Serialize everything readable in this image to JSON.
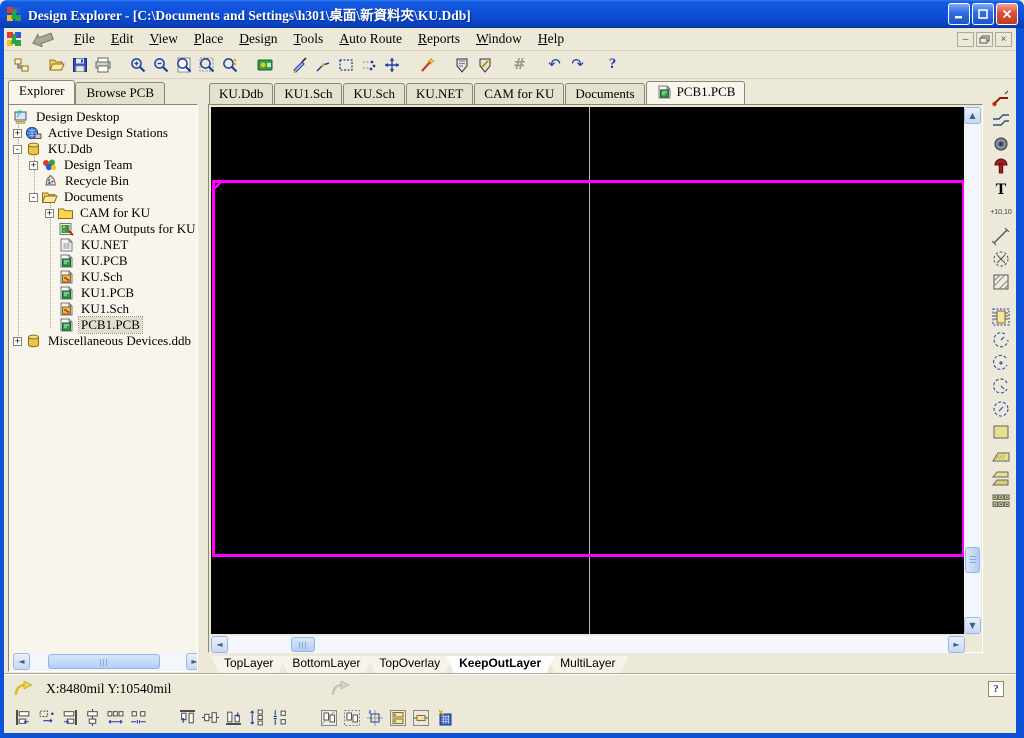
{
  "window": {
    "title": "Design Explorer - [C:\\Documents and Settings\\h301\\桌面\\新資料夾\\KU.Ddb]",
    "controls": [
      "minimize",
      "maximize",
      "close"
    ],
    "mdi_controls": [
      "minimize",
      "restore",
      "close"
    ],
    "mdi_glyphs": {
      "minimize": "–",
      "close": "×"
    }
  },
  "menu": {
    "items": [
      {
        "label": "File"
      },
      {
        "label": "Edit"
      },
      {
        "label": "View"
      },
      {
        "label": "Place"
      },
      {
        "label": "Design"
      },
      {
        "label": "Tools"
      },
      {
        "label": "Auto Route"
      },
      {
        "label": "Reports"
      },
      {
        "label": "Window"
      },
      {
        "label": "Help"
      }
    ]
  },
  "toolbar": {
    "icons": [
      "toggle-explorer-panel",
      "open-document",
      "save",
      "print",
      "zoom-in",
      "zoom-out",
      "zoom-document",
      "zoom-area",
      "zoom-selection",
      "browse-spreadsheet",
      "slice-tracks",
      "draw-line",
      "select-area",
      "clear-selection",
      "move-object",
      "wizard",
      "online-drc",
      "setup-drc",
      "toggle-grid",
      "undo",
      "redo",
      "help"
    ],
    "glyphs": {
      "grid": "#",
      "undo": "↶",
      "redo": "↷",
      "help": "?"
    }
  },
  "panel_tabs": [
    {
      "label": "Explorer",
      "active": true
    },
    {
      "label": "Browse PCB",
      "active": false
    }
  ],
  "tree": {
    "items": [
      {
        "label": "Design Desktop",
        "icon": "design-desktop",
        "level": 0,
        "expand": "",
        "selected": false
      },
      {
        "label": "Active Design Stations",
        "icon": "design-stations",
        "level": 1,
        "expand": "+",
        "selected": false
      },
      {
        "label": "KU.Ddb",
        "icon": "database",
        "level": 1,
        "expand": "-",
        "selected": false
      },
      {
        "label": "Design Team",
        "icon": "design-team",
        "level": 2,
        "expand": "+",
        "selected": false
      },
      {
        "label": "Recycle Bin",
        "icon": "recycle-bin",
        "level": 2,
        "expand": "",
        "selected": false
      },
      {
        "label": "Documents",
        "icon": "folder-open",
        "level": 2,
        "expand": "-",
        "selected": false
      },
      {
        "label": "CAM for KU",
        "icon": "folder-closed",
        "level": 3,
        "expand": "+",
        "selected": false
      },
      {
        "label": "CAM Outputs for KU",
        "icon": "cam-output",
        "level": 3,
        "expand": "",
        "selected": false
      },
      {
        "label": "KU.NET",
        "icon": "netlist-document",
        "level": 3,
        "expand": "",
        "selected": false
      },
      {
        "label": "KU.PCB",
        "icon": "pcb-document",
        "level": 3,
        "expand": "",
        "selected": false
      },
      {
        "label": "KU.Sch",
        "icon": "schematic-document",
        "level": 3,
        "expand": "",
        "selected": false
      },
      {
        "label": "KU1.PCB",
        "icon": "pcb-document",
        "level": 3,
        "expand": "",
        "selected": false
      },
      {
        "label": "KU1.Sch",
        "icon": "schematic-document",
        "level": 3,
        "expand": "",
        "selected": false
      },
      {
        "label": "PCB1.PCB",
        "icon": "pcb-document",
        "level": 3,
        "expand": "",
        "selected": true
      },
      {
        "label": "Miscellaneous Devices.ddb",
        "icon": "database",
        "level": 1,
        "expand": "+",
        "selected": false
      }
    ]
  },
  "document_tabs": [
    {
      "label": "KU.Ddb",
      "active": false
    },
    {
      "label": "KU1.Sch",
      "active": false
    },
    {
      "label": "KU.Sch",
      "active": false
    },
    {
      "label": "KU.NET",
      "active": false
    },
    {
      "label": "CAM for KU",
      "active": false
    },
    {
      "label": "Documents",
      "active": false
    },
    {
      "label": "PCB1.PCB",
      "active": true,
      "icon": "pcb-document"
    }
  ],
  "canvas": {
    "background": "#000000",
    "board_outline_color": "#FF00FF",
    "grid_line_color": "#B9B9B9"
  },
  "layer_tabs": [
    {
      "label": "TopLayer",
      "active": false
    },
    {
      "label": "BottomLayer",
      "active": false
    },
    {
      "label": "TopOverlay",
      "active": false
    },
    {
      "label": "KeepOutLayer",
      "active": true
    },
    {
      "label": "MultiLayer",
      "active": false
    }
  ],
  "placement_toolbar": {
    "icons": [
      "interactive-routing",
      "multiple-traces",
      "pad",
      "via",
      "string",
      "coordinate",
      "dimension",
      "room",
      "fill-hatched",
      "component",
      "arc-edge",
      "arc-center",
      "arc-angle",
      "full-circle",
      "fill",
      "polygon-plane",
      "split-plane",
      "pad-array"
    ],
    "string_glyph": "T",
    "coordinate_label": "+10,10"
  },
  "status_bar": {
    "coordinates": "X:8480mil Y:10540mil",
    "icons": [
      "cross-probe-arrow",
      "inactive-arrow",
      "help-bubble"
    ],
    "help_glyph": "?"
  },
  "bottom_toolbar": {
    "groups": [
      [
        "align-left",
        "move-to-grid",
        "align-right",
        "center-horizontal",
        "distribute-horizontal",
        "space-equal-horizontal"
      ],
      [
        "align-top",
        "center-vertical",
        "align-bottom",
        "distribute-vertical",
        "space-equal-vertical"
      ],
      [
        "arrange-within-room",
        "arrange-outside-board",
        "shove-components",
        "component-to-grid",
        "place-component",
        "placement-rooms"
      ]
    ]
  }
}
